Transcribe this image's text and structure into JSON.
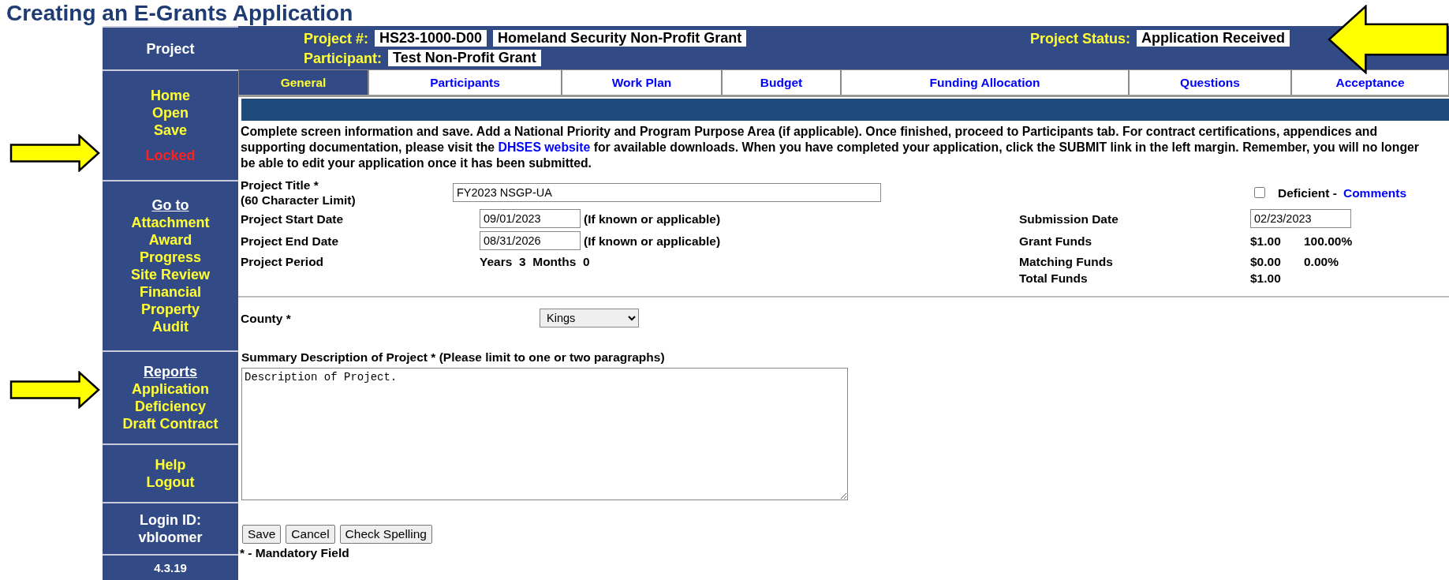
{
  "slide_title": "Creating an E-Grants Application",
  "header": {
    "project_label": "Project #:",
    "project_number": "HS23-1000-D00",
    "project_name": "Homeland Security Non-Profit Grant",
    "status_label": "Project Status:",
    "status": "Application Received",
    "participant_label": "Participant:",
    "participant": "Test Non-Profit Grant"
  },
  "sidebar": {
    "title": "Project",
    "sections": [
      {
        "kind": "menu",
        "items": [
          {
            "label": "Home",
            "kind": "link"
          },
          {
            "label": "Open",
            "kind": "link"
          },
          {
            "label": "Save",
            "kind": "link"
          },
          {
            "label": "Locked",
            "kind": "alert"
          }
        ]
      },
      {
        "kind": "menu",
        "heading": "Go to",
        "items": [
          {
            "label": "Attachment",
            "kind": "link"
          },
          {
            "label": "Award",
            "kind": "link"
          },
          {
            "label": "Progress",
            "kind": "link"
          },
          {
            "label": "Site Review",
            "kind": "link"
          },
          {
            "label": "Financial",
            "kind": "link"
          },
          {
            "label": "Property",
            "kind": "link"
          },
          {
            "label": "Audit",
            "kind": "link"
          }
        ]
      },
      {
        "kind": "menu",
        "heading": "Reports",
        "items": [
          {
            "label": "Application",
            "kind": "link"
          },
          {
            "label": "Deficiency",
            "kind": "link"
          },
          {
            "label": "Draft Contract",
            "kind": "link"
          }
        ]
      },
      {
        "kind": "menu",
        "items": [
          {
            "label": "Help",
            "kind": "link"
          },
          {
            "label": "Logout",
            "kind": "link"
          }
        ]
      },
      {
        "kind": "info",
        "items": [
          {
            "label": "Login ID:",
            "kind": "text"
          },
          {
            "label": "vbloomer",
            "kind": "text"
          }
        ]
      },
      {
        "kind": "version",
        "items": [
          {
            "label": "4.3.19",
            "kind": "text"
          }
        ]
      }
    ]
  },
  "tabs": [
    {
      "label": "General",
      "selected": true
    },
    {
      "label": "Participants",
      "selected": false
    },
    {
      "label": "Work Plan",
      "selected": false
    },
    {
      "label": "Budget",
      "selected": false
    },
    {
      "label": "Funding Allocation",
      "selected": false
    },
    {
      "label": "Questions",
      "selected": false
    },
    {
      "label": "Acceptance",
      "selected": false
    }
  ],
  "instructions": {
    "before_link": "Complete screen information and save. Add a National Priority and Program Purpose Area (if applicable). Once finished, proceed to Participants tab. For contract certifications, appendices and supporting documentation, please visit the ",
    "link": "DHSES website",
    "after_link": " for available downloads. When you have completed your application, click the SUBMIT link in the left margin. Remember, you will no longer be able to edit your application once it has been submitted."
  },
  "form": {
    "project_title": {
      "label": "Project Title *",
      "hint": "(60 Character Limit)",
      "value": "FY2023 NSGP-UA"
    },
    "deficient": {
      "checked": false,
      "label": "Deficient -",
      "link": "Comments"
    },
    "start_date": {
      "label": "Project Start Date",
      "value": "09/01/2023",
      "note": "(If known or applicable)"
    },
    "end_date": {
      "label": "Project End Date",
      "value": "08/31/2026",
      "note": "(If known or applicable)"
    },
    "period": {
      "label": "Project Period",
      "years_label": "Years",
      "years": "3",
      "months_label": "Months",
      "months": "0"
    },
    "submission_date": {
      "label": "Submission Date",
      "value": "02/23/2023"
    },
    "funds": [
      {
        "label": "Grant Funds",
        "amount": "$1.00",
        "percent": "100.00%"
      },
      {
        "label": "Matching Funds",
        "amount": "$0.00",
        "percent": "0.00%"
      },
      {
        "label": "Total Funds",
        "amount": "$1.00"
      }
    ],
    "county": {
      "label": "County *",
      "value": "Kings"
    },
    "summary": {
      "label": "Summary Description of Project * (Please limit to one or two paragraphs)",
      "value": "Description of Project."
    },
    "buttons": [
      "Save",
      "Cancel",
      "Check Spelling"
    ],
    "mandatory_note": "* - Mandatory Field"
  }
}
